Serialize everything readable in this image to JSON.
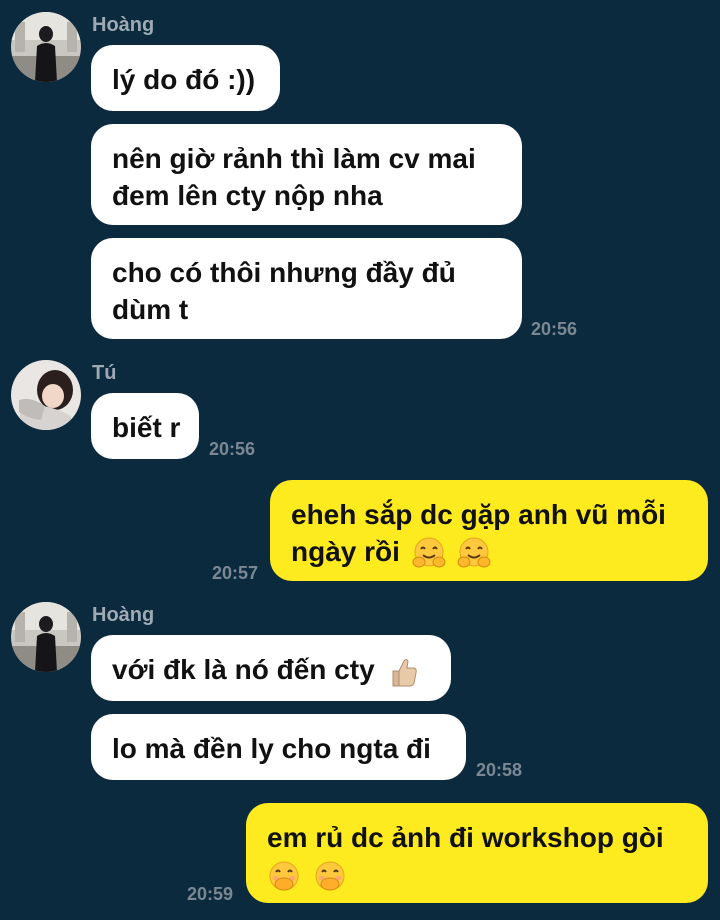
{
  "theme": {
    "background": "#0b2a3e",
    "incoming_bubble": "#ffffff",
    "outgoing_bubble": "#fdea1f",
    "sender_name_color": "#9ea9b4",
    "time_color": "#7b8793"
  },
  "messages": {
    "group1": {
      "sender": "Hoàng",
      "lines": [
        "lý do đó :))",
        "nên giờ rảnh thì làm cv mai\nđem lên cty nộp nha",
        "cho có thôi nhưng đầy đủ\ndùm t"
      ],
      "time": "20:56"
    },
    "group2": {
      "sender": "Tú",
      "lines": [
        "biết r"
      ],
      "time": "20:56"
    },
    "outgoing1": {
      "line1": "eheh sắp dc gặp anh vũ mỗi",
      "line2": "ngày rồi",
      "emoji": [
        "hugging-face-icon",
        "hugging-face-icon"
      ],
      "time": "20:57"
    },
    "group3": {
      "sender": "Hoàng",
      "line1": "với đk là nó đến cty",
      "emoji": "thumbs-up-icon",
      "line2": "lo mà đền ly cho ngta đi",
      "time": "20:58"
    },
    "outgoing2": {
      "line1": "em rủ dc ảnh đi workshop gòi",
      "emoji": [
        "face-with-hand-over-mouth-icon",
        "face-with-hand-over-mouth-icon"
      ],
      "time": "20:59"
    }
  }
}
